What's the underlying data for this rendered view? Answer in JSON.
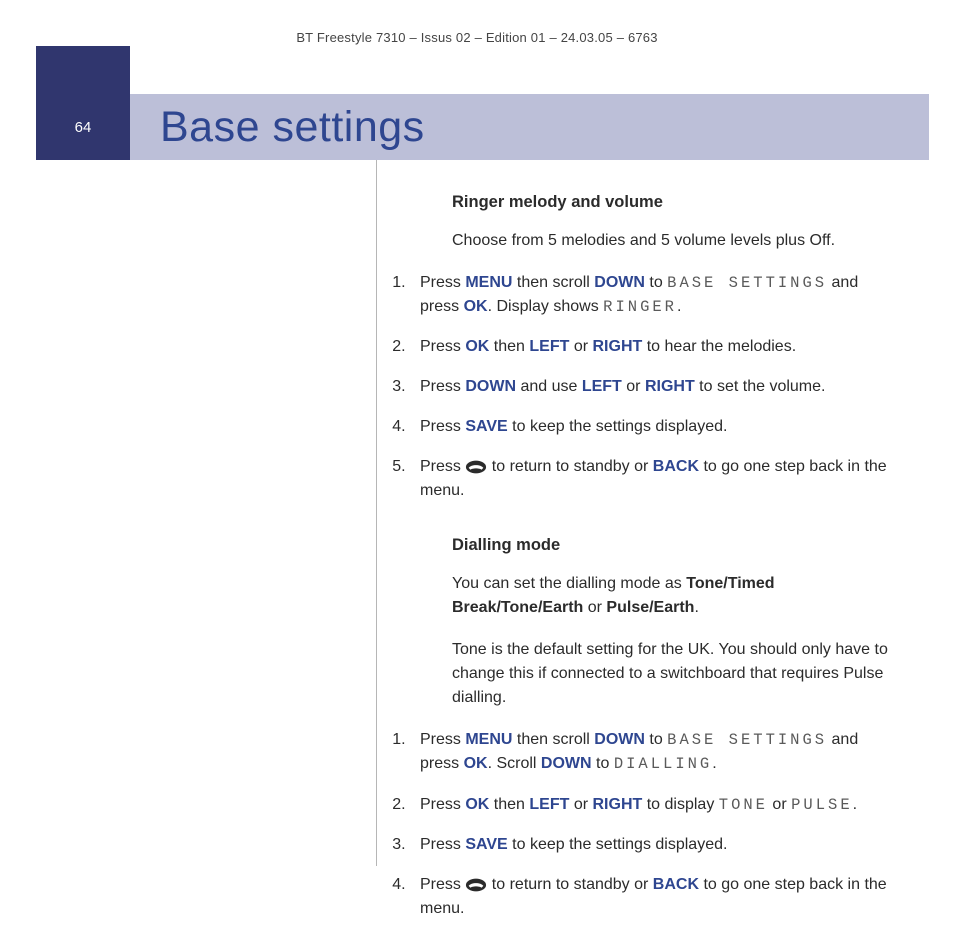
{
  "headerLine": "BT Freestyle 7310 – Issus 02 – Edition 01 – 24.03.05 – 6763",
  "pageNumber": "64",
  "pageTitle": "Base settings",
  "keys": {
    "menu": "MENU",
    "down": "DOWN",
    "ok": "OK",
    "left": "LEFT",
    "right": "RIGHT",
    "save": "SAVE",
    "back": "BACK"
  },
  "lcd": {
    "baseSettings": "BASE SETTINGS",
    "ringer": "RINGER",
    "dialling": "DIALLING",
    "tone": "TONE",
    "pulse": "PULSE"
  },
  "icons": {
    "endCall": "end-call-icon"
  },
  "section1": {
    "heading": "Ringer melody and volume",
    "intro": "Choose from 5 melodies and 5 volume levels plus Off.",
    "steps": {
      "s1a": "Press ",
      "s1b": " then scroll ",
      "s1c": " to ",
      "s1d": " and press ",
      "s1e": ". Display shows ",
      "s1f": ".",
      "s2a": "Press ",
      "s2b": " then ",
      "s2c": " or ",
      "s2d": " to hear the melodies.",
      "s3a": "Press ",
      "s3b": " and use ",
      "s3c": " or ",
      "s3d": " to set the volume.",
      "s4a": "Press ",
      "s4b": " to keep the settings displayed.",
      "s5a": "Press ",
      "s5b": " to return to standby or ",
      "s5c": " to go one step back in the menu."
    }
  },
  "section2": {
    "heading": "Dialling mode",
    "intro1a": "You can set the dialling mode as ",
    "intro1_opt1": "Tone/Timed Break/Tone/Earth",
    "intro1_or": " or ",
    "intro1_opt2": "Pulse/Earth",
    "intro1b": ".",
    "intro2": "Tone is the default setting for the UK. You should only have to change this if connected to a switchboard that requires Pulse dialling.",
    "steps": {
      "s1a": "Press ",
      "s1b": " then scroll ",
      "s1c": " to ",
      "s1d": " and press ",
      "s1e": ". Scroll ",
      "s1f": " to ",
      "s1g": ".",
      "s2a": "Press ",
      "s2b": " then ",
      "s2c": " or ",
      "s2d": " to display ",
      "s2e": " or ",
      "s2f": ".",
      "s3a": "Press ",
      "s3b": " to keep the settings displayed.",
      "s4a": "Press ",
      "s4b": " to return to standby or ",
      "s4c": " to go one step back in the menu."
    }
  }
}
